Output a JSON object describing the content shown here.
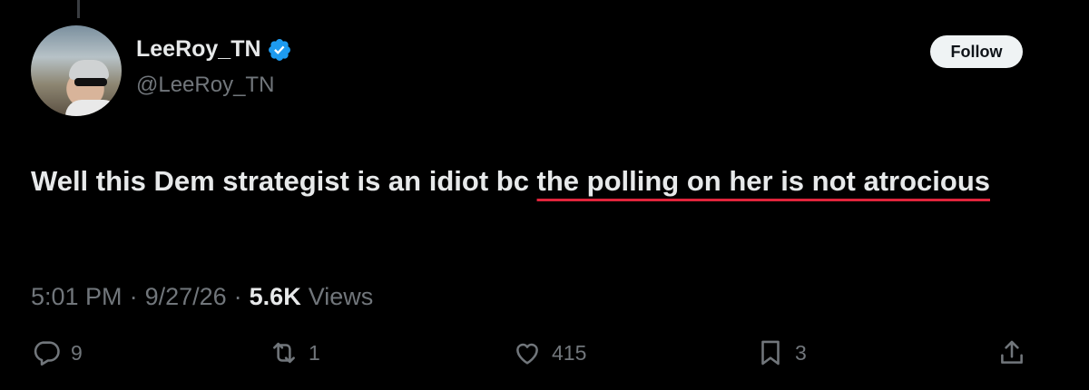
{
  "author": {
    "display_name": "LeeRoy_TN",
    "handle": "@LeeRoy_TN",
    "verified": true,
    "verified_color": "#1d9bf0"
  },
  "follow_button": {
    "label": "Follow"
  },
  "tweet": {
    "text_plain": "Well this Dem strategist is an idiot bc ",
    "text_underlined": "the polling on her is not atrocious",
    "underline_color": "#e0243b"
  },
  "meta": {
    "time": "5:01 PM",
    "date": "9/27/26",
    "views_count": "5.6K",
    "views_label": "Views",
    "separator": "·"
  },
  "actions": {
    "replies": "9",
    "reposts": "1",
    "likes": "415",
    "bookmarks": "3"
  },
  "icons": {
    "reply": "reply-icon",
    "repost": "repost-icon",
    "like": "like-icon",
    "bookmark": "bookmark-icon",
    "share": "share-icon",
    "verified": "verified-badge-icon"
  }
}
